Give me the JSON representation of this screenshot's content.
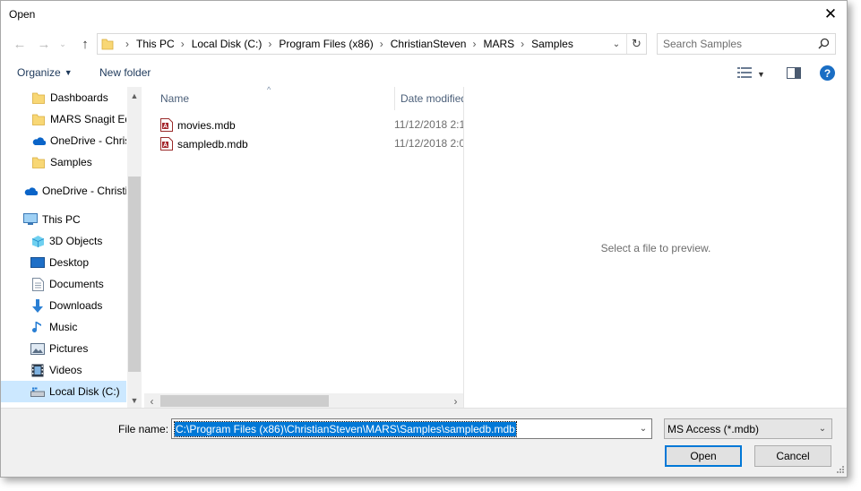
{
  "window": {
    "title": "Open",
    "close_glyph": "✕"
  },
  "address": {
    "crumbs": [
      "This PC",
      "Local Disk (C:)",
      "Program Files (x86)",
      "ChristianSteven",
      "MARS",
      "Samples"
    ]
  },
  "search": {
    "placeholder": "Search Samples"
  },
  "toolbar": {
    "organize_label": "Organize",
    "new_folder_label": "New folder",
    "help_label": "?"
  },
  "nav": {
    "items": [
      {
        "label": "Dashboards",
        "icon": "folder-icon"
      },
      {
        "label": "MARS Snagit Edi",
        "icon": "folder-icon"
      },
      {
        "label": "OneDrive - Chris",
        "icon": "onedrive-icon"
      },
      {
        "label": "Samples",
        "icon": "folder-icon"
      },
      {
        "label": "OneDrive - Christi",
        "icon": "onedrive-icon"
      },
      {
        "label": "This PC",
        "icon": "pc-icon"
      },
      {
        "label": "3D Objects",
        "icon": "cube-icon"
      },
      {
        "label": "Desktop",
        "icon": "desktop-icon"
      },
      {
        "label": "Documents",
        "icon": "documents-icon"
      },
      {
        "label": "Downloads",
        "icon": "download-icon"
      },
      {
        "label": "Music",
        "icon": "music-icon"
      },
      {
        "label": "Pictures",
        "icon": "pictures-icon"
      },
      {
        "label": "Videos",
        "icon": "videos-icon"
      },
      {
        "label": "Local Disk (C:)",
        "icon": "drive-icon",
        "selected": true
      }
    ]
  },
  "files": {
    "columns": {
      "name": "Name",
      "date": "Date modified"
    },
    "rows": [
      {
        "name": "movies.mdb",
        "date": "11/12/2018 2:1"
      },
      {
        "name": "sampledb.mdb",
        "date": "11/12/2018 2:0"
      }
    ]
  },
  "preview": {
    "message": "Select a file to preview."
  },
  "bottom": {
    "file_name_label": "File name:",
    "file_name_value": "C:\\Program Files (x86)\\ChristianSteven\\MARS\\Samples\\sampledb.mdb",
    "file_type_value": "MS Access (*.mdb)",
    "open_label": "Open",
    "cancel_label": "Cancel"
  }
}
